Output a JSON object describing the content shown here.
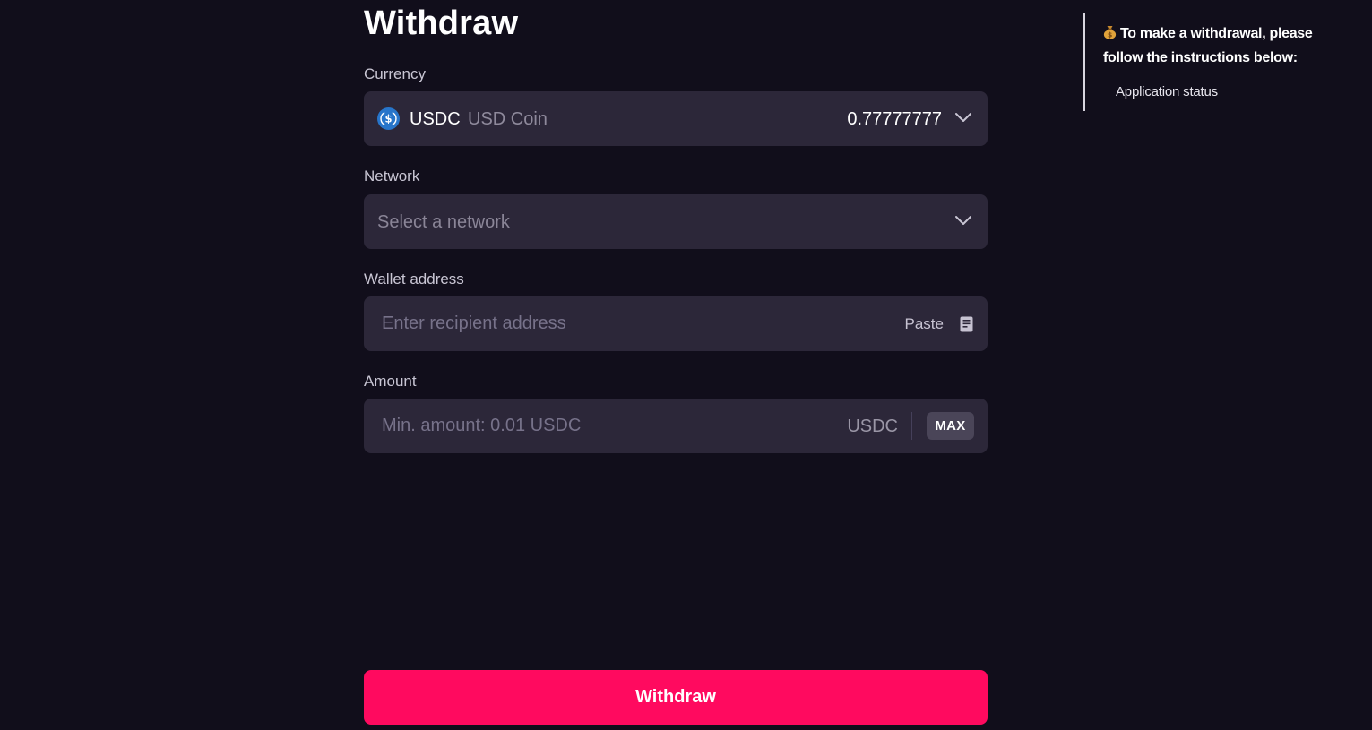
{
  "page": {
    "title": "Withdraw"
  },
  "currency": {
    "label": "Currency",
    "symbol": "USDC",
    "name": "USD Coin",
    "balance": "0.77777777",
    "icon": "usdc-coin-icon",
    "icon_color": "#2775ca"
  },
  "network": {
    "label": "Network",
    "placeholder": "Select a network"
  },
  "wallet": {
    "label": "Wallet address",
    "placeholder": "Enter recipient address",
    "paste_label": "Paste"
  },
  "amount": {
    "label": "Amount",
    "placeholder": "Min. amount: 0.01 USDC",
    "currency": "USDC",
    "max_label": "MAX"
  },
  "submit": {
    "label": "Withdraw",
    "color": "#ff0a5f"
  },
  "instructions": {
    "heading": "To make a withdrawal, please follow the instructions below:",
    "heading_icon": "money-bag-icon",
    "link_label": "Application status"
  }
}
